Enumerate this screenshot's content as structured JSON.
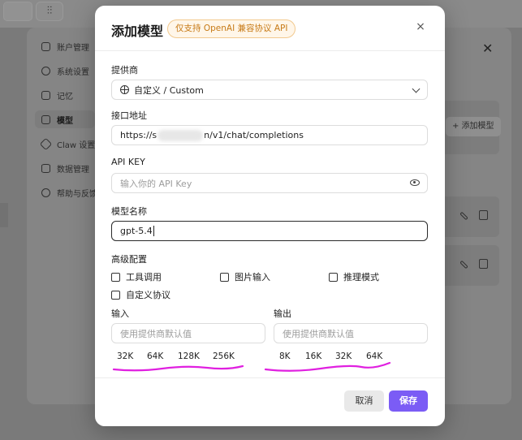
{
  "background": {
    "sidebar": [
      {
        "label": "账户管理",
        "icon": "user-icon"
      },
      {
        "label": "系统设置",
        "icon": "gear-icon"
      },
      {
        "label": "记忆",
        "icon": "memory-icon"
      },
      {
        "label": "模型",
        "icon": "cube-icon"
      },
      {
        "label": "Claw 设置",
        "icon": "claw-icon"
      },
      {
        "label": "数据管理",
        "icon": "database-icon"
      },
      {
        "label": "帮助与反馈",
        "icon": "help-icon"
      }
    ],
    "add_model_label": "+ 添加模型",
    "close_glyph": "✕"
  },
  "modal": {
    "title": "添加模型",
    "badge": "仅支持 OpenAI 兼容协议 API",
    "close_glyph": "×",
    "provider": {
      "label": "提供商",
      "value": "自定义 / Custom"
    },
    "endpoint": {
      "label": "接口地址",
      "prefix": "https://s",
      "suffix": "n/v1/chat/completions"
    },
    "api_key": {
      "label": "API KEY",
      "placeholder": "输入你的 API Key"
    },
    "model_name": {
      "label": "模型名称",
      "value": "gpt-5.4"
    },
    "advanced": {
      "label": "高级配置",
      "options": [
        "工具调用",
        "图片输入",
        "推理模式",
        "自定义协议"
      ]
    },
    "input": {
      "label": "输入",
      "placeholder": "使用提供商默认值",
      "presets": [
        "32K",
        "64K",
        "128K",
        "256K"
      ]
    },
    "output": {
      "label": "输出",
      "placeholder": "使用提供商默认值",
      "presets": [
        "8K",
        "16K",
        "32K",
        "64K"
      ]
    },
    "cancel_label": "取消",
    "save_label": "保存",
    "accent": "#7b5cf5",
    "annotation_color": "#e020e0"
  }
}
